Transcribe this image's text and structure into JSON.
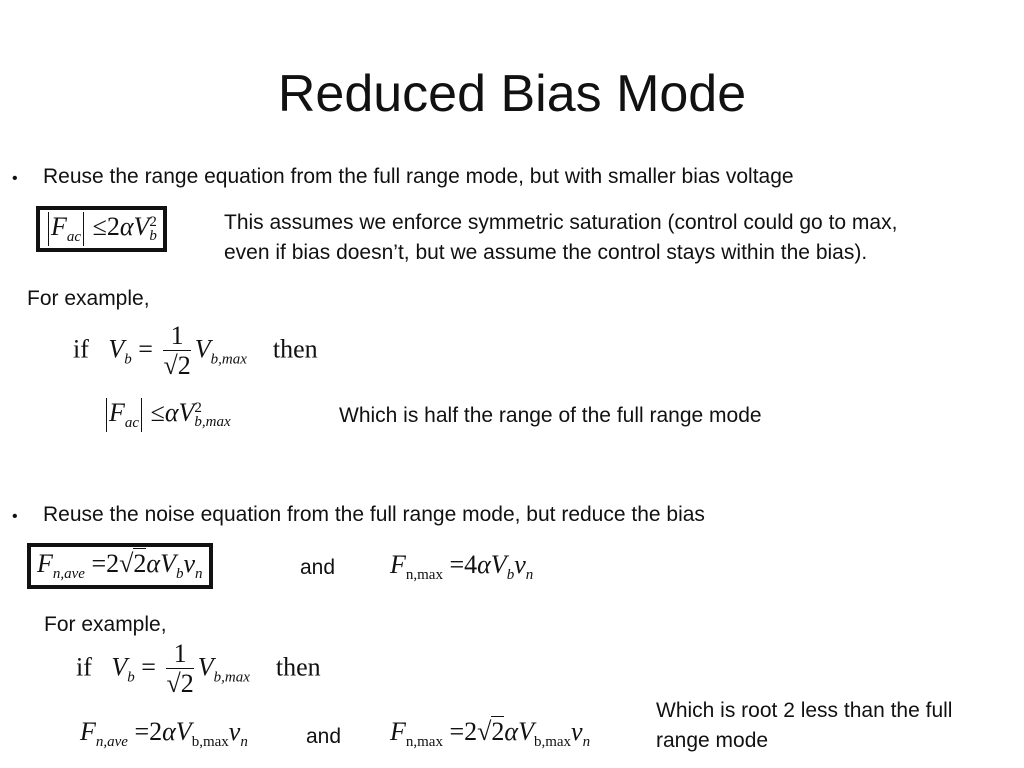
{
  "slide": {
    "title": "Reduced Bias Mode",
    "bullet_glyph": "•",
    "section1": {
      "bullet_text": "Reuse the range equation from the full range mode, but with smaller bias voltage",
      "boxed_equation": "|F_ac| ≤ 2αV_b^2",
      "note_line1": "This assumes we enforce symmetric saturation (control could go to max,",
      "note_line2": "even if bias doesn’t, but we assume the control stays within the bias).",
      "example_label": "For example,",
      "condition_if": "if",
      "condition_then": "then",
      "condition_equation": "V_b = (1/√2) V_b,max",
      "result_equation": "|F_ac| ≤ αV_b,max^2",
      "result_note": "Which is half the range of the full range mode"
    },
    "section2": {
      "bullet_text": "Reuse the noise equation from the full range mode, but reduce the bias",
      "boxed_equation": "F_n,ave = 2√2 αV_b v_n",
      "and_label": "and",
      "second_equation": "F_n,max = 4αV_b v_n",
      "example_label": "For example,",
      "condition_if": "if",
      "condition_then": "then",
      "condition_equation": "V_b = (1/√2) V_b,max",
      "result_equation1": "F_n,ave = 2αV_b,max v_n",
      "result_and": "and",
      "result_equation2": "F_n,max = 2√2 αV_b,max v_n",
      "result_note_line1": "Which is root 2 less than the full",
      "result_note_line2": "range mode"
    },
    "symbols": {
      "F": "F",
      "V": "V",
      "v": "v",
      "alpha": "α",
      "leq": "≤",
      "eq": "=",
      "two": "2",
      "four": "4",
      "one": "1",
      "sqrt": "√",
      "ac": "ac",
      "b": "b",
      "n": "n",
      "sq": "2",
      "bmax": "b,max",
      "nave": "n,ave",
      "nmax": "n,max"
    }
  }
}
